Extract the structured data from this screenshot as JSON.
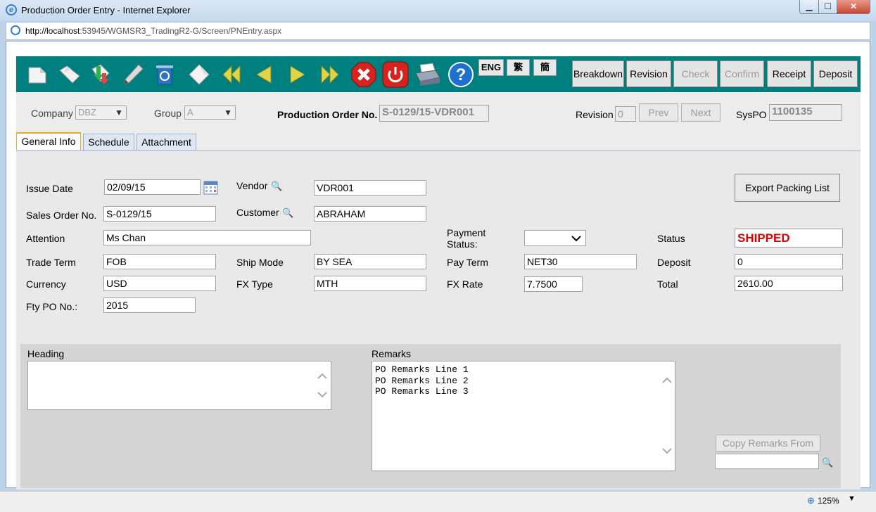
{
  "window": {
    "title": "Production Order Entry - Internet Explorer",
    "url_host": "http://localhost",
    "url_rest": ":53945/WGMSR3_TradingR2-G/Screen/PNEntry.aspx",
    "zoom": "125%"
  },
  "toolbar": {
    "icons": [
      "new-doc-icon",
      "open-folder-icon",
      "import-export-icon",
      "edit-pencil-icon",
      "recycle-bin-icon",
      "eraser-icon",
      "first-record-icon",
      "previous-record-icon",
      "next-record-icon",
      "last-record-icon",
      "cancel-icon",
      "power-icon",
      "print-icon",
      "help-icon"
    ],
    "lang": [
      "ENG",
      "繁",
      "簡"
    ],
    "buttons": {
      "breakdown": "Breakdown",
      "revision": "Revision",
      "check": "Check",
      "confirm": "Confirm",
      "receipt": "Receipt",
      "deposit": "Deposit"
    }
  },
  "header": {
    "company_label": "Company",
    "company_value": "DBZ",
    "group_label": "Group",
    "group_value": "A",
    "po_label": "Production Order No.",
    "po_value": "S-0129/15-VDR001",
    "revision_label": "Revision",
    "revision_value": "0",
    "prev": "Prev",
    "next": "Next",
    "syspo_label": "SysPO",
    "syspo_value": "1100135"
  },
  "tabs": [
    "General Info",
    "Schedule",
    "Attachment"
  ],
  "form": {
    "issue_date_label": "Issue Date",
    "issue_date": "02/09/15",
    "sales_order_label": "Sales Order No.",
    "sales_order": "S-0129/15",
    "attention_label": "Attention",
    "attention": "Ms Chan",
    "trade_term_label": "Trade Term",
    "trade_term": "FOB",
    "currency_label": "Currency",
    "currency": "USD",
    "fty_po_label": "Fty PO No.:",
    "fty_po": "2015",
    "vendor_label": "Vendor",
    "vendor": "VDR001",
    "customer_label": "Customer",
    "customer": "ABRAHAM",
    "ship_mode_label": "Ship Mode",
    "ship_mode": "BY SEA",
    "fx_type_label": "FX Type",
    "fx_type": "MTH",
    "payment_status_label_1": "Payment",
    "payment_status_label_2": "Status:",
    "pay_term_label": "Pay Term",
    "pay_term": "NET30",
    "fx_rate_label": "FX Rate",
    "fx_rate": "7.7500",
    "status_label": "Status",
    "status": "SHIPPED",
    "deposit_label": "Deposit",
    "deposit": "0",
    "total_label": "Total",
    "total": "2610.00",
    "export_button": "Export Packing List"
  },
  "lower": {
    "heading_label": "Heading",
    "remarks_label": "Remarks",
    "remarks_lines": [
      "PO Remarks Line 1",
      "PO Remarks Line 2",
      "PO Remarks Line 3"
    ],
    "copy_remarks_button": "Copy Remarks From"
  },
  "colors": {
    "toolbar": "#007f7f",
    "status_text": "#e00000",
    "tab_active_border": "#e6a92a"
  }
}
